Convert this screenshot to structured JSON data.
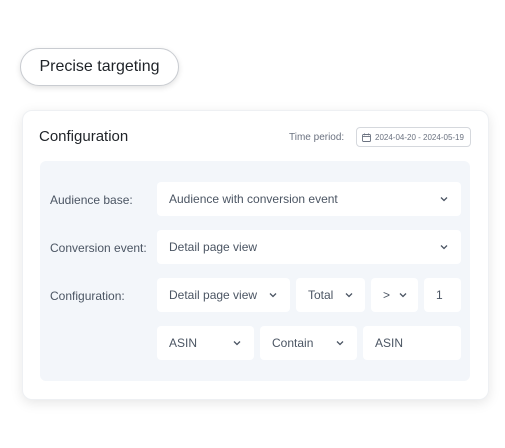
{
  "badge": {
    "label": "Precise targeting"
  },
  "card": {
    "title": "Configuration",
    "time_period_label": "Time period:",
    "date_range": "2024-04-20 - 2024-05-19"
  },
  "form": {
    "audience_base": {
      "label": "Audience base:",
      "value": "Audience with conversion event"
    },
    "conversion_event": {
      "label": "Conversion event:",
      "value": "Detail page view"
    },
    "configuration": {
      "label": "Configuration:",
      "event": "Detail page view",
      "aggregation": "Total",
      "operator": ">",
      "count": "1",
      "attribute": "ASIN",
      "match": "Contain",
      "value_placeholder": "ASIN"
    }
  },
  "icons": {
    "calendar": "calendar-icon",
    "chevron": "chevron-down-icon"
  },
  "colors": {
    "panel_bg": "#f3f6fa",
    "field_bg": "#ffffff",
    "text": "#4b5563"
  }
}
